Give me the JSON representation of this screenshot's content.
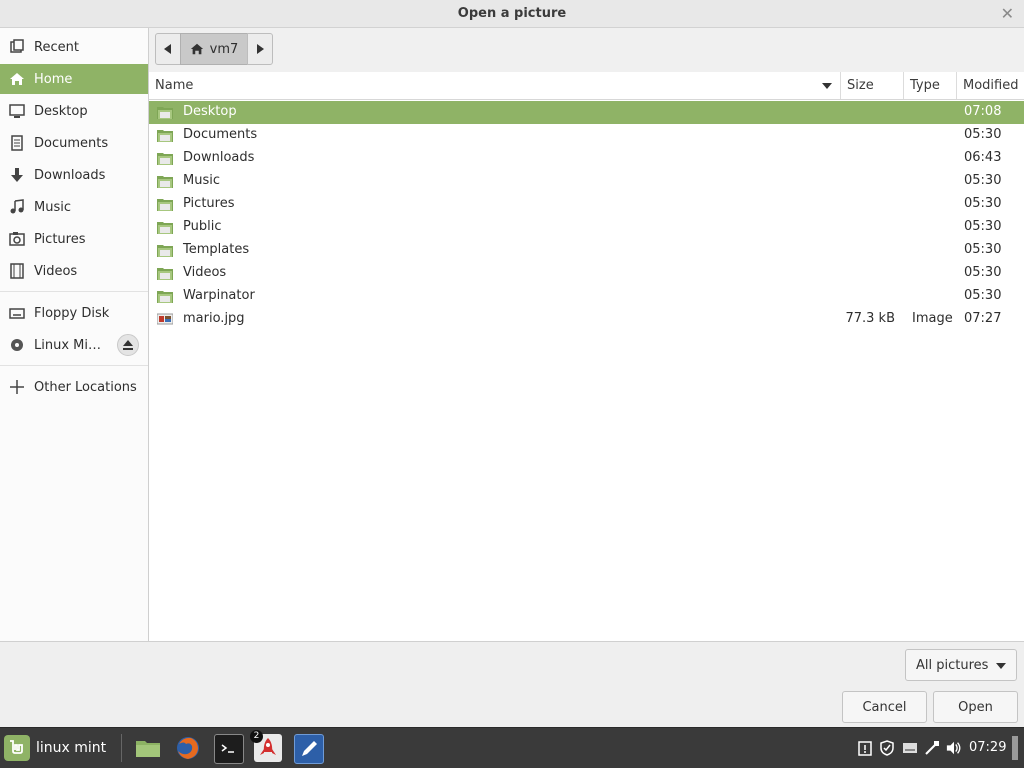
{
  "window": {
    "title": "Open a picture"
  },
  "sidebar": {
    "items": [
      {
        "label": "Recent",
        "icon": "clock-icon",
        "selected": false
      },
      {
        "label": "Home",
        "icon": "home-icon",
        "selected": true
      },
      {
        "label": "Desktop",
        "icon": "desktop-icon",
        "selected": false
      },
      {
        "label": "Documents",
        "icon": "document-icon",
        "selected": false
      },
      {
        "label": "Downloads",
        "icon": "download-icon",
        "selected": false
      },
      {
        "label": "Music",
        "icon": "music-icon",
        "selected": false
      },
      {
        "label": "Pictures",
        "icon": "pictures-icon",
        "selected": false
      },
      {
        "label": "Videos",
        "icon": "video-icon",
        "selected": false
      },
      {
        "label": "Floppy Disk",
        "icon": "floppy-icon",
        "selected": false
      },
      {
        "label": "Linux Min…",
        "icon": "disc-icon",
        "selected": false
      },
      {
        "label": "Other Locations",
        "icon": "plus-icon",
        "selected": false
      }
    ]
  },
  "pathbar": {
    "current": "vm7"
  },
  "columns": {
    "name": "Name",
    "size": "Size",
    "type": "Type",
    "modified": "Modified"
  },
  "files": [
    {
      "name": "Desktop",
      "size": "",
      "type": "",
      "modified": "07:08",
      "selected": true,
      "kind": "folder"
    },
    {
      "name": "Documents",
      "size": "",
      "type": "",
      "modified": "05:30",
      "selected": false,
      "kind": "folder"
    },
    {
      "name": "Downloads",
      "size": "",
      "type": "",
      "modified": "06:43",
      "selected": false,
      "kind": "folder"
    },
    {
      "name": "Music",
      "size": "",
      "type": "",
      "modified": "05:30",
      "selected": false,
      "kind": "folder"
    },
    {
      "name": "Pictures",
      "size": "",
      "type": "",
      "modified": "05:30",
      "selected": false,
      "kind": "folder"
    },
    {
      "name": "Public",
      "size": "",
      "type": "",
      "modified": "05:30",
      "selected": false,
      "kind": "folder"
    },
    {
      "name": "Templates",
      "size": "",
      "type": "",
      "modified": "05:30",
      "selected": false,
      "kind": "folder"
    },
    {
      "name": "Videos",
      "size": "",
      "type": "",
      "modified": "05:30",
      "selected": false,
      "kind": "folder"
    },
    {
      "name": "Warpinator",
      "size": "",
      "type": "",
      "modified": "05:30",
      "selected": false,
      "kind": "folder"
    },
    {
      "name": "mario.jpg",
      "size": "77.3 kB",
      "type": "Image",
      "modified": "07:27",
      "selected": false,
      "kind": "image"
    }
  ],
  "filter": {
    "selected": "All pictures"
  },
  "buttons": {
    "cancel": "Cancel",
    "open": "Open"
  },
  "taskbar": {
    "menu_label": "linux mint",
    "badge_count": "2",
    "clock": "07:29"
  },
  "colors": {
    "accent": "#8fb366",
    "taskbar": "#3a3a3a",
    "folder": "#8cb263"
  }
}
